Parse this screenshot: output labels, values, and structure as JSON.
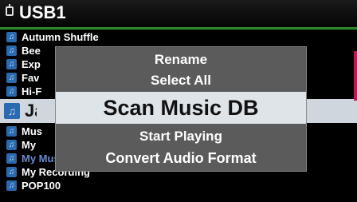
{
  "header": {
    "title": "USB1",
    "icon": "usb-icon"
  },
  "list": [
    {
      "label": "Autumn Shuffle",
      "icon": "music-folder-icon"
    },
    {
      "label": "Bee",
      "icon": "music-folder-icon"
    },
    {
      "label": "Exp",
      "icon": "music-folder-icon"
    },
    {
      "label": "Fav",
      "icon": "music-folder-icon"
    },
    {
      "label": "Hi-F",
      "icon": "music-folder-icon"
    },
    {
      "label": "Jaz",
      "icon": "music-folder-icon"
    },
    {
      "label": "Mus",
      "icon": "music-folder-icon"
    },
    {
      "label": "My",
      "icon": "music-folder-icon"
    },
    {
      "label": "My Music",
      "icon": "music-folder-icon"
    },
    {
      "label": "My Recording",
      "icon": "music-folder-icon"
    },
    {
      "label": "POP100",
      "icon": "music-folder-icon"
    }
  ],
  "menu": {
    "items": [
      {
        "label": "Rename"
      },
      {
        "label": "Select All"
      },
      {
        "label": "Scan Music DB"
      },
      {
        "label": "Start Playing"
      },
      {
        "label": "Convert Audio Format"
      }
    ],
    "selected_index": 2
  },
  "colors": {
    "header_line": "#2d8a2d",
    "folder_icon": "#2a6ab0",
    "popup_bg": "#5b5b5b",
    "selection_bg": "#dfe4e8",
    "accent": "#c0185a"
  }
}
